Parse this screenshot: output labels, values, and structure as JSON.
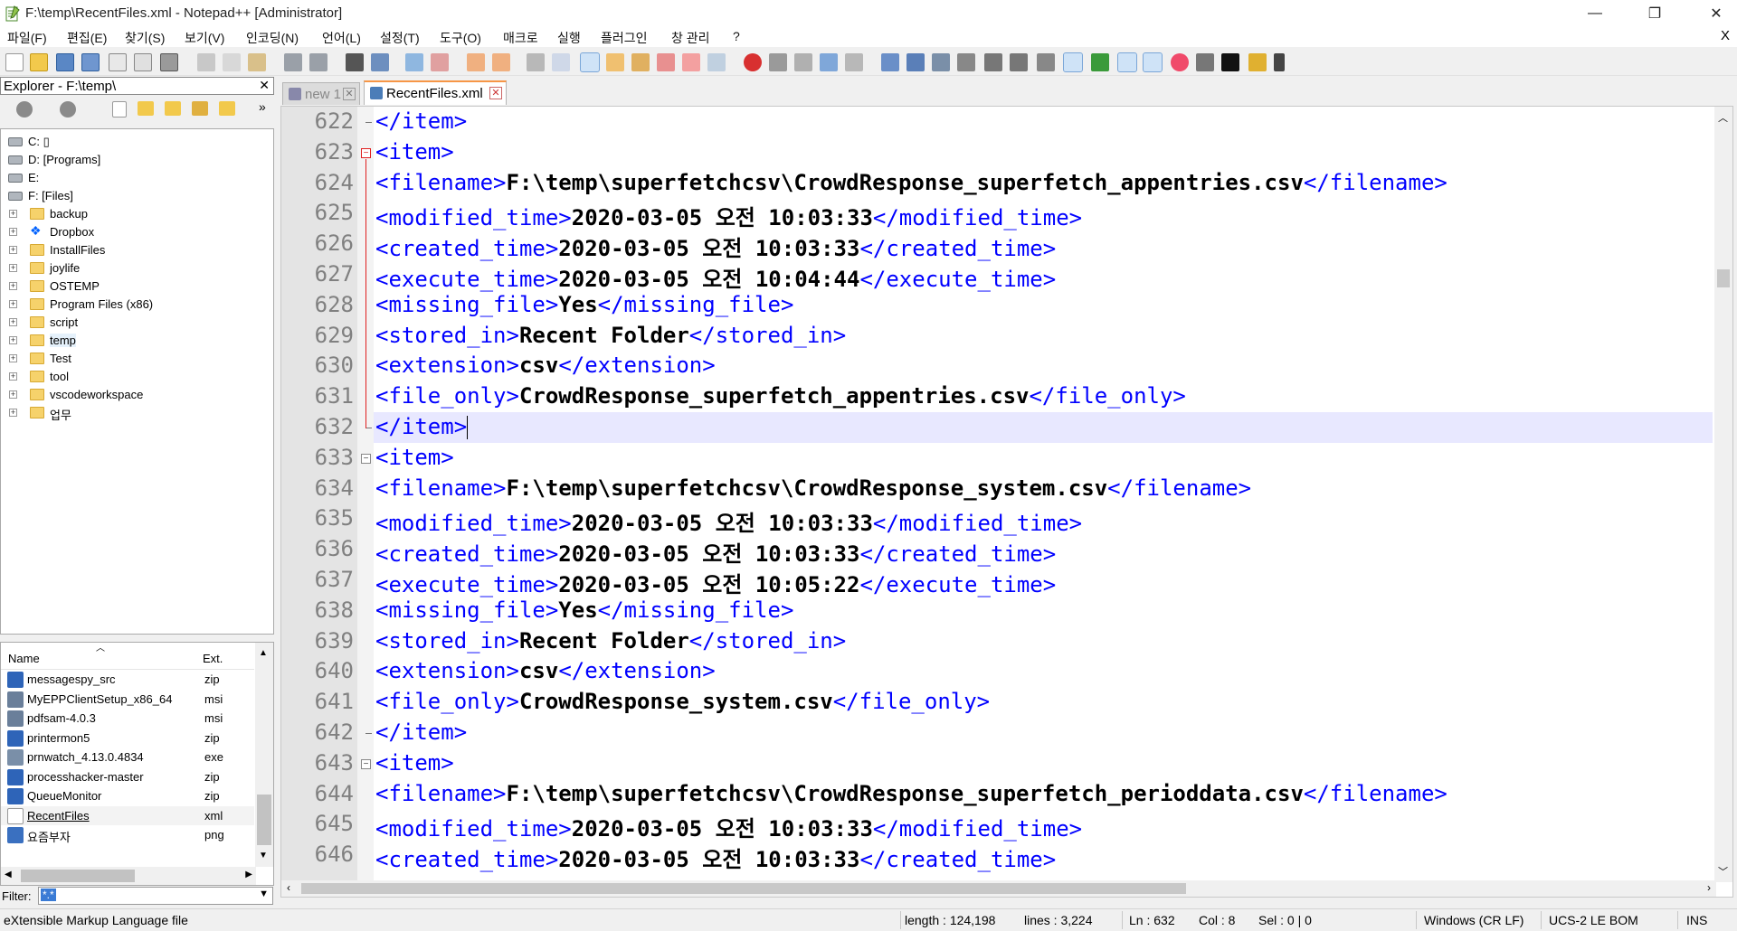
{
  "window": {
    "title": "F:\\temp\\RecentFiles.xml - Notepad++ [Administrator]",
    "min": "—",
    "max": "❐",
    "close": "✕"
  },
  "menu": {
    "items": [
      "파일(F)",
      "편집(E)",
      "찾기(S)",
      "보기(V)",
      "인코딩(N)",
      "언어(L)",
      "설정(T)",
      "도구(O)",
      "매크로",
      "실행",
      "플러그인",
      "창 관리",
      "?"
    ],
    "close_x": "X"
  },
  "explorer": {
    "title": "Explorer - F:\\temp\\",
    "close": "✕",
    "chevron": "»",
    "tree": [
      {
        "label": "C: ▯",
        "kind": "drive"
      },
      {
        "label": "D: [Programs]",
        "kind": "drive"
      },
      {
        "label": "E:",
        "kind": "drive"
      },
      {
        "label": "F: [Files]",
        "kind": "drive"
      },
      {
        "label": "backup",
        "kind": "folder"
      },
      {
        "label": "Dropbox",
        "kind": "dropbox"
      },
      {
        "label": "InstallFiles",
        "kind": "folder"
      },
      {
        "label": "joylife",
        "kind": "folder"
      },
      {
        "label": "OSTEMP",
        "kind": "folder"
      },
      {
        "label": "Program Files (x86)",
        "kind": "folder"
      },
      {
        "label": "script",
        "kind": "folder"
      },
      {
        "label": "temp",
        "kind": "folder",
        "selected": true
      },
      {
        "label": "Test",
        "kind": "folder"
      },
      {
        "label": "tool",
        "kind": "folder"
      },
      {
        "label": "vscodeworkspace",
        "kind": "folder"
      },
      {
        "label": "업무",
        "kind": "folder"
      }
    ],
    "list_headers": {
      "name": "Name",
      "ext": "Ext."
    },
    "files": [
      {
        "name": "messagespy_src",
        "ext": "zip",
        "type": "zip"
      },
      {
        "name": "MyEPPClientSetup_x86_64",
        "ext": "msi",
        "type": "msi"
      },
      {
        "name": "pdfsam-4.0.3",
        "ext": "msi",
        "type": "msi"
      },
      {
        "name": "printermon5",
        "ext": "zip",
        "type": "zip"
      },
      {
        "name": "prnwatch_4.13.0.4834",
        "ext": "exe",
        "type": "exe"
      },
      {
        "name": "processhacker-master",
        "ext": "zip",
        "type": "zip"
      },
      {
        "name": "QueueMonitor",
        "ext": "zip",
        "type": "zip"
      },
      {
        "name": "RecentFiles",
        "ext": "xml",
        "type": "xml",
        "selected": true
      },
      {
        "name": "요즘부자",
        "ext": "png",
        "type": "png"
      }
    ],
    "filter_label": "Filter:",
    "filter_value": "*.*"
  },
  "tabs": [
    {
      "label": "new 1",
      "active": false
    },
    {
      "label": "RecentFiles.xml",
      "active": true
    }
  ],
  "editor": {
    "current_line": 632,
    "lines": [
      {
        "n": "622",
        "parts": [
          [
            "t",
            "</item>"
          ]
        ]
      },
      {
        "n": "623",
        "parts": [
          [
            "t",
            "<item>"
          ]
        ]
      },
      {
        "n": "624",
        "parts": [
          [
            "t",
            "<filename>"
          ],
          [
            "v",
            "F:\\temp\\superfetchcsv\\CrowdResponse_superfetch_appentries.csv"
          ],
          [
            "t",
            "</filename>"
          ]
        ]
      },
      {
        "n": "625",
        "parts": [
          [
            "t",
            "<modified_time>"
          ],
          [
            "v",
            "2020-03-05 오전 10:03:33"
          ],
          [
            "t",
            "</modified_time>"
          ]
        ]
      },
      {
        "n": "626",
        "parts": [
          [
            "t",
            "<created_time>"
          ],
          [
            "v",
            "2020-03-05 오전 10:03:33"
          ],
          [
            "t",
            "</created_time>"
          ]
        ]
      },
      {
        "n": "627",
        "parts": [
          [
            "t",
            "<execute_time>"
          ],
          [
            "v",
            "2020-03-05 오전 10:04:44"
          ],
          [
            "t",
            "</execute_time>"
          ]
        ]
      },
      {
        "n": "628",
        "parts": [
          [
            "t",
            "<missing_file>"
          ],
          [
            "v",
            "Yes"
          ],
          [
            "t",
            "</missing_file>"
          ]
        ]
      },
      {
        "n": "629",
        "parts": [
          [
            "t",
            "<stored_in>"
          ],
          [
            "v",
            "Recent Folder"
          ],
          [
            "t",
            "</stored_in>"
          ]
        ]
      },
      {
        "n": "630",
        "parts": [
          [
            "t",
            "<extension>"
          ],
          [
            "v",
            "csv"
          ],
          [
            "t",
            "</extension>"
          ]
        ]
      },
      {
        "n": "631",
        "parts": [
          [
            "t",
            "<file_only>"
          ],
          [
            "v",
            "CrowdResponse_superfetch_appentries.csv"
          ],
          [
            "t",
            "</file_only>"
          ]
        ]
      },
      {
        "n": "632",
        "parts": [
          [
            "t",
            "</item>"
          ]
        ]
      },
      {
        "n": "633",
        "parts": [
          [
            "t",
            "<item>"
          ]
        ]
      },
      {
        "n": "634",
        "parts": [
          [
            "t",
            "<filename>"
          ],
          [
            "v",
            "F:\\temp\\superfetchcsv\\CrowdResponse_system.csv"
          ],
          [
            "t",
            "</filename>"
          ]
        ]
      },
      {
        "n": "635",
        "parts": [
          [
            "t",
            "<modified_time>"
          ],
          [
            "v",
            "2020-03-05 오전 10:03:33"
          ],
          [
            "t",
            "</modified_time>"
          ]
        ]
      },
      {
        "n": "636",
        "parts": [
          [
            "t",
            "<created_time>"
          ],
          [
            "v",
            "2020-03-05 오전 10:03:33"
          ],
          [
            "t",
            "</created_time>"
          ]
        ]
      },
      {
        "n": "637",
        "parts": [
          [
            "t",
            "<execute_time>"
          ],
          [
            "v",
            "2020-03-05 오전 10:05:22"
          ],
          [
            "t",
            "</execute_time>"
          ]
        ]
      },
      {
        "n": "638",
        "parts": [
          [
            "t",
            "<missing_file>"
          ],
          [
            "v",
            "Yes"
          ],
          [
            "t",
            "</missing_file>"
          ]
        ]
      },
      {
        "n": "639",
        "parts": [
          [
            "t",
            "<stored_in>"
          ],
          [
            "v",
            "Recent Folder"
          ],
          [
            "t",
            "</stored_in>"
          ]
        ]
      },
      {
        "n": "640",
        "parts": [
          [
            "t",
            "<extension>"
          ],
          [
            "v",
            "csv"
          ],
          [
            "t",
            "</extension>"
          ]
        ]
      },
      {
        "n": "641",
        "parts": [
          [
            "t",
            "<file_only>"
          ],
          [
            "v",
            "CrowdResponse_system.csv"
          ],
          [
            "t",
            "</file_only>"
          ]
        ]
      },
      {
        "n": "642",
        "parts": [
          [
            "t",
            "</item>"
          ]
        ]
      },
      {
        "n": "643",
        "parts": [
          [
            "t",
            "<item>"
          ]
        ]
      },
      {
        "n": "644",
        "parts": [
          [
            "t",
            "<filename>"
          ],
          [
            "v",
            "F:\\temp\\superfetchcsv\\CrowdResponse_superfetch_perioddata.csv"
          ],
          [
            "t",
            "</filename>"
          ]
        ]
      },
      {
        "n": "645",
        "parts": [
          [
            "t",
            "<modified_time>"
          ],
          [
            "v",
            "2020-03-05 오전 10:03:33"
          ],
          [
            "t",
            "</modified_time>"
          ]
        ]
      },
      {
        "n": "646",
        "parts": [
          [
            "t",
            "<created_time>"
          ],
          [
            "v",
            "2020-03-05 오전 10:03:33"
          ],
          [
            "t",
            "</created_time>"
          ]
        ]
      }
    ]
  },
  "status": {
    "file_type": "eXtensible Markup Language file",
    "length": "length : 124,198",
    "lines": "lines : 3,224",
    "ln": "Ln : 632",
    "col": "Col : 8",
    "sel": "Sel : 0 | 0",
    "eol": "Windows (CR LF)",
    "encoding": "UCS-2 LE BOM",
    "mode": "INS"
  },
  "colors": {
    "tag": "#0000ff",
    "current_line": "#e8e8ff",
    "tab_accent": "#f79646"
  }
}
